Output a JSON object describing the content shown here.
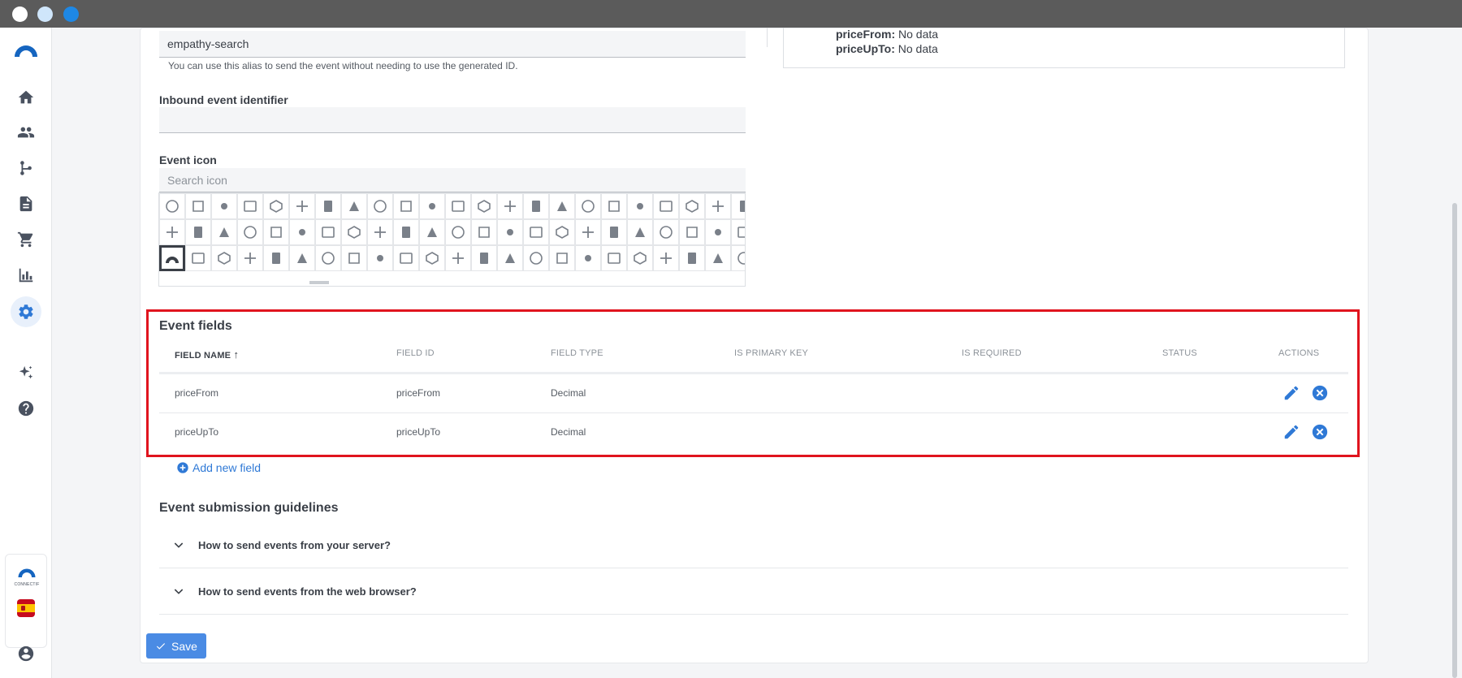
{
  "form": {
    "alias_value": "empathy-search",
    "alias_help": "You can use this alias to send the event without needing to use the generated ID.",
    "inbound_label": "Inbound event identifier",
    "inbound_value": "",
    "event_icon_label": "Event icon",
    "search_icon_placeholder": "Search icon"
  },
  "preview": {
    "lines": [
      {
        "key": "priceFrom:",
        "value": "No data"
      },
      {
        "key": "priceUpTo:",
        "value": "No data"
      }
    ]
  },
  "event_fields": {
    "title": "Event fields",
    "columns": [
      "FIELD NAME",
      "FIELD ID",
      "FIELD TYPE",
      "IS PRIMARY KEY",
      "IS REQUIRED",
      "STATUS",
      "ACTIONS"
    ],
    "sort_indicator": "↑",
    "rows": [
      {
        "name": "priceFrom",
        "id": "priceFrom",
        "type": "Decimal",
        "primary": "",
        "required": "",
        "status": ""
      },
      {
        "name": "priceUpTo",
        "id": "priceUpTo",
        "type": "Decimal",
        "primary": "",
        "required": "",
        "status": ""
      }
    ],
    "add_label": "Add new field"
  },
  "guidelines": {
    "title": "Event submission guidelines",
    "items": [
      {
        "label": "How to send events from your server?"
      },
      {
        "label": "How to send events from the web browser?"
      }
    ]
  },
  "save_label": "Save",
  "brand_text": "CONNECTIF",
  "colors": {
    "accent": "#2f79d6",
    "danger_outline": "#e0141e",
    "save_bg": "#4a8be4"
  }
}
